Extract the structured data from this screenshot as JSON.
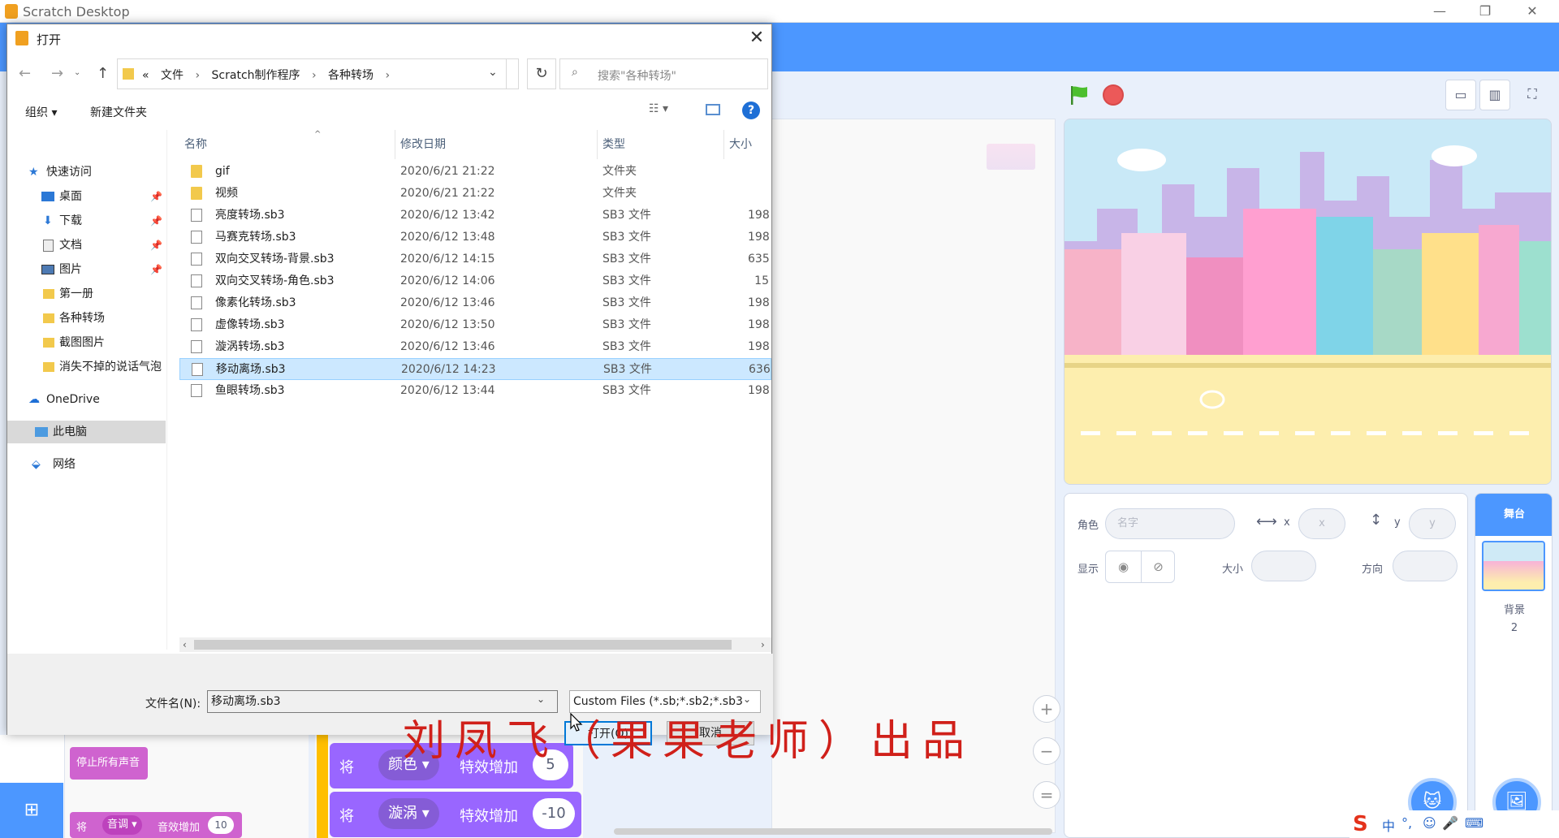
{
  "window": {
    "title": "Scratch Desktop",
    "min": "—",
    "restore": "❐",
    "close": "✕"
  },
  "stage_controls": {
    "mode_small": "▭",
    "mode_normal": "▥",
    "fullscreen": "⛶"
  },
  "sprite_panel": {
    "sprite_label": "角色",
    "name_placeholder": "名字",
    "x_label": "x",
    "x_placeholder": "x",
    "y_label": "y",
    "y_placeholder": "y",
    "show_label": "显示",
    "size_label": "大小",
    "direction_label": "方向"
  },
  "stage_selector": {
    "tab": "舞台",
    "backdrop_label": "背景",
    "backdrop_count": "2"
  },
  "palette": {
    "stop_all_sounds": "停止所有声音",
    "set_label": "将",
    "sound_dropdown": "音调",
    "sound_effect": "音效增加",
    "sound_value": "10"
  },
  "code_blocks": [
    {
      "set": "将",
      "effect": "颜色",
      "action": "特效增加",
      "value": "5"
    },
    {
      "set": "将",
      "effect": "漩涡",
      "action": "特效增加",
      "value": "-10"
    }
  ],
  "zoom": {
    "in": "+",
    "out": "−",
    "reset": "="
  },
  "dialog": {
    "title": "打开",
    "close": "✕",
    "breadcrumb": [
      "«",
      "文件",
      "Scratch制作程序",
      "各种转场"
    ],
    "search_placeholder": "搜索\"各种转场\"",
    "organize": "组织 ▾",
    "new_folder": "新建文件夹",
    "nav": [
      {
        "label": "快速访问",
        "icon": "star-icon"
      },
      {
        "label": "桌面",
        "icon": "desktop-icon"
      },
      {
        "label": "下载",
        "icon": "download-icon"
      },
      {
        "label": "文档",
        "icon": "document-icon"
      },
      {
        "label": "图片",
        "icon": "picture-icon"
      },
      {
        "label": "第一册",
        "icon": "folder-icon"
      },
      {
        "label": "各种转场",
        "icon": "folder-icon"
      },
      {
        "label": "截图图片",
        "icon": "folder-icon"
      },
      {
        "label": "消失不掉的说话气泡",
        "icon": "folder-icon"
      },
      {
        "label": "OneDrive",
        "icon": "cloud-icon"
      },
      {
        "label": "此电脑",
        "icon": "computer-icon"
      },
      {
        "label": "网络",
        "icon": "network-icon"
      }
    ],
    "columns": {
      "name": "名称",
      "date": "修改日期",
      "type": "类型",
      "size": "大小"
    },
    "files": [
      {
        "name": "gif",
        "date": "2020/6/21 21:22",
        "type": "文件夹",
        "size": "",
        "kind": "folder"
      },
      {
        "name": "视频",
        "date": "2020/6/21 21:22",
        "type": "文件夹",
        "size": "",
        "kind": "folder"
      },
      {
        "name": "亮度转场.sb3",
        "date": "2020/6/12 13:42",
        "type": "SB3 文件",
        "size": "198",
        "kind": "file"
      },
      {
        "name": "马赛克转场.sb3",
        "date": "2020/6/12 13:48",
        "type": "SB3 文件",
        "size": "198",
        "kind": "file"
      },
      {
        "name": "双向交叉转场-背景.sb3",
        "date": "2020/6/12 14:15",
        "type": "SB3 文件",
        "size": "635",
        "kind": "file"
      },
      {
        "name": "双向交叉转场-角色.sb3",
        "date": "2020/6/12 14:06",
        "type": "SB3 文件",
        "size": "15",
        "kind": "file"
      },
      {
        "name": "像素化转场.sb3",
        "date": "2020/6/12 13:46",
        "type": "SB3 文件",
        "size": "198",
        "kind": "file"
      },
      {
        "name": "虚像转场.sb3",
        "date": "2020/6/12 13:50",
        "type": "SB3 文件",
        "size": "198",
        "kind": "file"
      },
      {
        "name": "漩涡转场.sb3",
        "date": "2020/6/12 13:46",
        "type": "SB3 文件",
        "size": "198",
        "kind": "file"
      },
      {
        "name": "移动离场.sb3",
        "date": "2020/6/12 14:23",
        "type": "SB3 文件",
        "size": "636",
        "kind": "file",
        "selected": true
      },
      {
        "name": "鱼眼转场.sb3",
        "date": "2020/6/12 13:44",
        "type": "SB3 文件",
        "size": "198",
        "kind": "file"
      }
    ],
    "filename_label": "文件名(N):",
    "filename_value": "移动离场.sb3",
    "filter_value": "Custom Files (*.sb;*.sb2;*.sb3",
    "open_button": "打开(O)",
    "cancel_button": "取消"
  },
  "watermark": "刘凤飞（果果老师）出品",
  "ime": {
    "s": "S",
    "zh": "中",
    "punct": "°,",
    "emoji": "☺",
    "mic": "🎤",
    "kbd": "⌨"
  },
  "colors": {
    "scratch_blue": "#4c97ff",
    "looks_purple": "#9966ff",
    "sound_pink": "#cf63cf",
    "watermark_red": "#d0201a",
    "selection": "#cce8ff"
  }
}
